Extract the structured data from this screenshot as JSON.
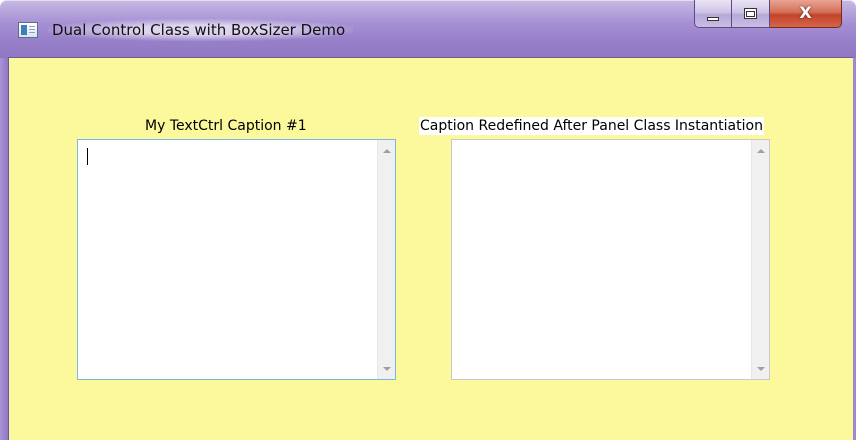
{
  "window": {
    "title": "Dual Control Class with BoxSizer Demo",
    "background_color": "#fbf99c",
    "title_icon": "app-window-icon",
    "controls": {
      "minimize_icon": "minimize-icon",
      "maximize_icon": "maximize-icon",
      "close_label": "X"
    }
  },
  "panels": [
    {
      "caption": "My TextCtrl Caption #1",
      "value": "",
      "has_focus": true
    },
    {
      "caption": "Caption Redefined After Panel Class Instantiation",
      "value": "",
      "has_focus": false
    }
  ]
}
